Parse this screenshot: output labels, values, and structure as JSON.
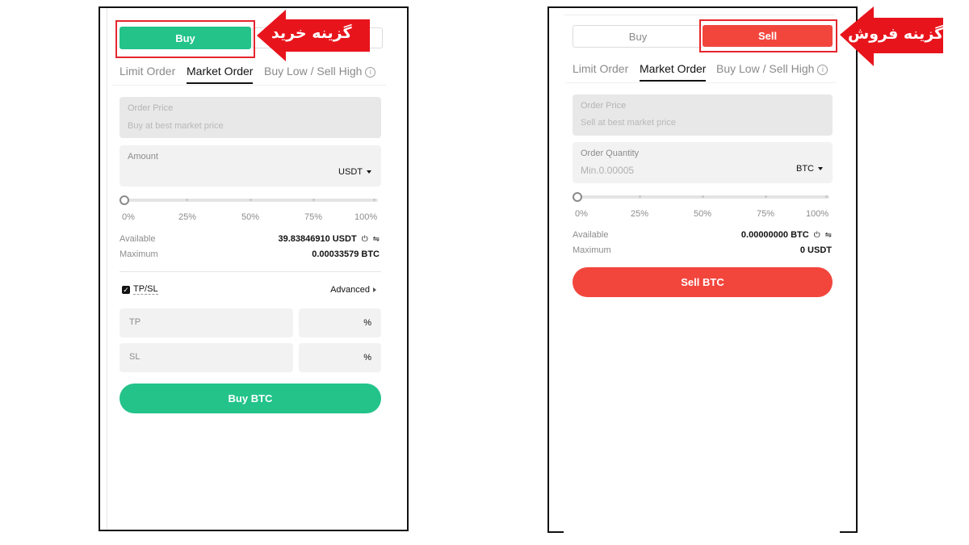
{
  "buy_panel": {
    "toggle": {
      "buy_label": "Buy",
      "sell_label": ""
    },
    "tabs": [
      {
        "label": "Limit Order"
      },
      {
        "label": "Market Order"
      },
      {
        "label": "Buy Low / Sell High"
      }
    ],
    "order_price": {
      "label": "Order Price",
      "placeholder": "Buy at best market price"
    },
    "amount": {
      "label": "Amount",
      "unit": "USDT"
    },
    "slider": {
      "ticks": [
        "0%",
        "25%",
        "50%",
        "75%",
        "100%"
      ],
      "value_percent": 0
    },
    "available": {
      "label": "Available",
      "value": "39.83846910 USDT"
    },
    "maximum": {
      "label": "Maximum",
      "value": "0.00033579 BTC"
    },
    "tpsl": {
      "label": "TP/SL",
      "checked": true,
      "advanced_label": "Advanced"
    },
    "tp": {
      "label": "TP",
      "unit": "%"
    },
    "sl": {
      "label": "SL",
      "unit": "%"
    },
    "cta_label": "Buy BTC",
    "callout": "گزینه خرید"
  },
  "sell_panel": {
    "toggle": {
      "buy_label": "Buy",
      "sell_label": "Sell"
    },
    "tabs": [
      {
        "label": "Limit Order"
      },
      {
        "label": "Market Order"
      },
      {
        "label": "Buy Low / Sell High"
      }
    ],
    "order_price": {
      "label": "Order Price",
      "placeholder": "Sell at best market price"
    },
    "order_quantity": {
      "label": "Order Quantity",
      "placeholder": "Min.0.00005",
      "unit": "BTC"
    },
    "slider": {
      "ticks": [
        "0%",
        "25%",
        "50%",
        "75%",
        "100%"
      ],
      "value_percent": 0
    },
    "available": {
      "label": "Available",
      "value": "0.00000000 BTC"
    },
    "maximum": {
      "label": "Maximum",
      "value": "0 USDT"
    },
    "cta_label": "Sell BTC",
    "callout": "گزینه فروش"
  },
  "colors": {
    "buy_green": "#23c38a",
    "sell_red": "#f2463d",
    "highlight_red": "#e5262e",
    "callout_red": "#e8141c"
  }
}
